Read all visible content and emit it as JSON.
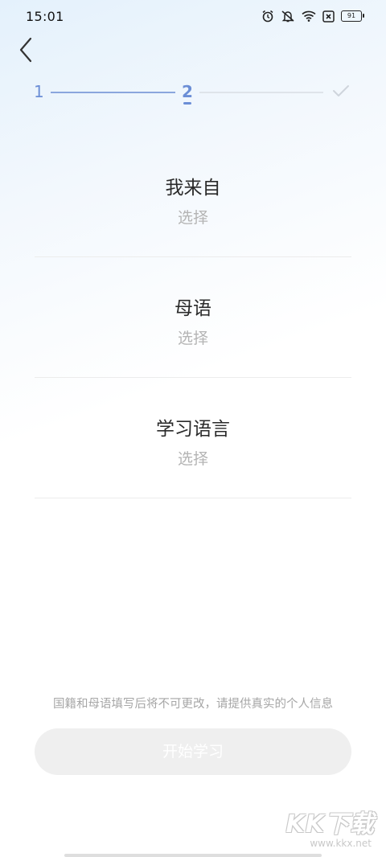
{
  "status_bar": {
    "time": "15:01",
    "icons": [
      "alarm-icon",
      "mute-icon",
      "wifi-icon",
      "sim-off-icon",
      "battery-icon"
    ],
    "battery_level": "91"
  },
  "header": {
    "back_icon": "chevron-left-icon"
  },
  "stepper": {
    "steps": [
      "1",
      "2"
    ],
    "current_step": 2,
    "final_icon": "check-icon",
    "colors": {
      "active": "#6b8ed6",
      "inactive": "#dfe4ea"
    }
  },
  "form": {
    "fields": [
      {
        "title": "我来自",
        "value": "选择"
      },
      {
        "title": "母语",
        "value": "选择"
      },
      {
        "title": "学习语言",
        "value": "选择"
      }
    ]
  },
  "footer": {
    "notice": "国籍和母语填写后将不可更改，请提供真实的个人信息",
    "start_button_label": "开始学习"
  },
  "watermark": {
    "logo": "KK下载",
    "url": "www.kkx.net"
  }
}
